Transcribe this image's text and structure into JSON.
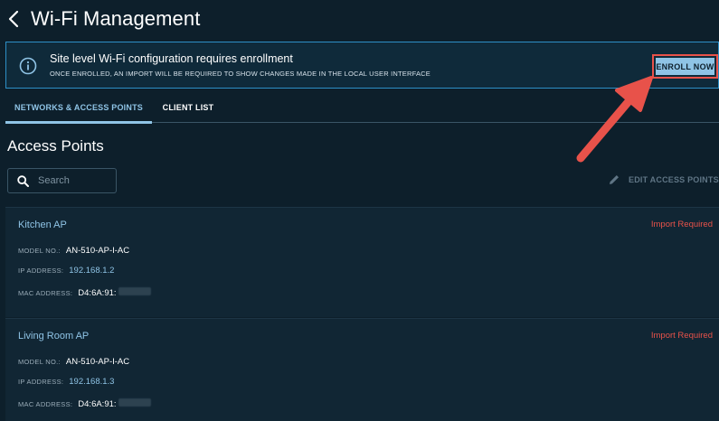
{
  "header": {
    "back_icon": "chevron-left-icon",
    "title": "Wi-Fi Management"
  },
  "banner": {
    "icon": "info-icon",
    "title": "Site level Wi-Fi configuration requires enrollment",
    "subtitle": "ONCE ENROLLED, AN IMPORT WILL BE REQUIRED TO SHOW CHANGES MADE IN THE LOCAL USER INTERFACE",
    "button_label": "ENROLL NOW"
  },
  "tabs": [
    {
      "label": "NETWORKS & ACCESS POINTS",
      "active": true
    },
    {
      "label": "CLIENT LIST",
      "active": false
    }
  ],
  "section": {
    "title": "Access Points",
    "search_placeholder": "Search",
    "edit_label": "EDIT ACCESS POINTS"
  },
  "access_points": [
    {
      "name": "Kitchen AP",
      "status": "Import Required",
      "model_label": "MODEL NO.:",
      "model": "AN-510-AP-I-AC",
      "ip_label": "IP ADDRESS:",
      "ip": "192.168.1.2",
      "mac_label": "MAC ADDRESS:",
      "mac": "D4:6A:91:"
    },
    {
      "name": "Living Room AP",
      "status": "Import Required",
      "model_label": "MODEL NO.:",
      "model": "AN-510-AP-I-AC",
      "ip_label": "IP ADDRESS:",
      "ip": "192.168.1.3",
      "mac_label": "MAC ADDRESS:",
      "mac": "D4:6A:91:"
    }
  ],
  "colors": {
    "background": "#0d1f2b",
    "accent": "#8fc4e6",
    "alert": "#e8524a",
    "annotation_arrow": "#e8524a"
  }
}
